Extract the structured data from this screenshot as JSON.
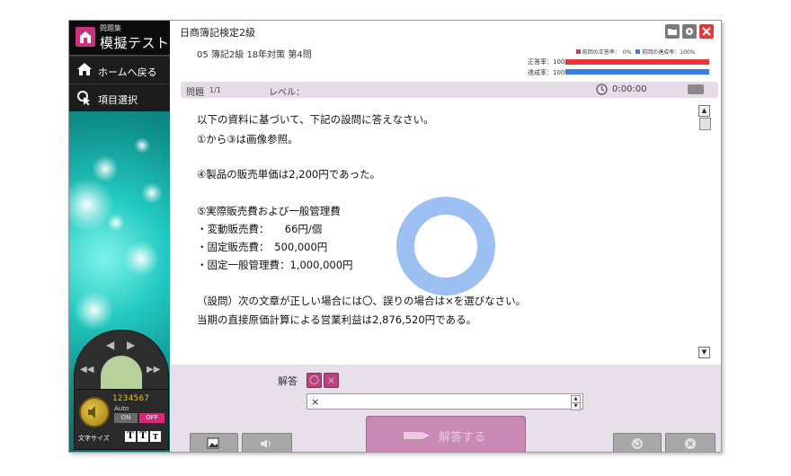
{
  "sidebar": {
    "logo_sub": "問題集",
    "logo_main": "模擬テスト",
    "home_label": "ホームへ戻る",
    "select_label": "項目選択"
  },
  "controls": {
    "digits": "1234567",
    "auto_label": "Auto",
    "on_label": "ON",
    "off_label": "OFF",
    "font_size_label": "文字サイズ",
    "font_size_buttons": [
      "T",
      "T",
      "T"
    ]
  },
  "window": {
    "title": "日商簿記検定2級"
  },
  "header": {
    "subtitle": "05 簿記2級 18年対策 第4問",
    "correct_rate_label": "正答率：100%",
    "achieve_rate_label": "達成率：100%",
    "legend_prev_correct": "前回の正答率：　0%",
    "legend_prev_achieve": "前回の達成率：100%",
    "colors": {
      "correct": "#e8343a",
      "achieve": "#3a7be8"
    }
  },
  "question_bar": {
    "label": "問題",
    "count": "1/1",
    "level_label": "レベル：",
    "timer": "0:00:00"
  },
  "content": {
    "lines": [
      "以下の資料に基づいて、下記の設問に答えなさい。",
      "①から③は画像参照。",
      "④製品の販売単価は2,200円であった。",
      "⑤実際販売費および一般管理費",
      "・変動販売費：　　66円/個",
      "・固定販売費：　500,000円",
      "・固定一般管理費：1,000,000円",
      "（設問）次の文章が正しい場合には〇、誤りの場合は×を選びなさい。",
      "当期の直接原価計算による営業利益は2,876,520円である。"
    ]
  },
  "answer": {
    "label": "解答",
    "chip_o": "〇",
    "chip_x": "×",
    "value": "×",
    "submit_label": "解答する"
  }
}
